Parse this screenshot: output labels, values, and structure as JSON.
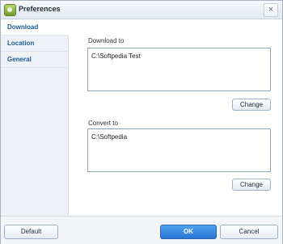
{
  "window": {
    "title": "Preferences"
  },
  "sidebar": {
    "items": [
      {
        "label": "Download"
      },
      {
        "label": "Location"
      },
      {
        "label": "General"
      }
    ]
  },
  "download": {
    "label": "Download to",
    "value": "C:\\Softpedia Test",
    "change_label": "Change"
  },
  "convert": {
    "label": "Convert to",
    "value": "C:\\Softpedia",
    "change_label": "Change"
  },
  "footer": {
    "default_label": "Default",
    "ok_label": "OK",
    "cancel_label": "Cancel"
  },
  "colors": {
    "accent": "#2b77d4",
    "sidebar_text": "#1c5a93"
  }
}
